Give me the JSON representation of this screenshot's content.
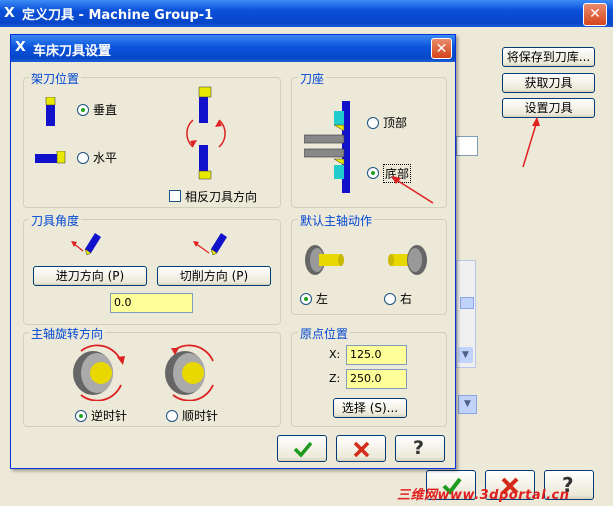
{
  "background_window": {
    "title": "定义刀具 - Machine Group-1",
    "buttons": {
      "save_to_library": "将保存到刀库...",
      "get_tool": "获取刀具",
      "set_tool": "设置刀具"
    }
  },
  "dialog": {
    "title": "车床刀具设置",
    "tool_mounting": {
      "label": "架刀位置",
      "vertical": "垂直",
      "horizontal": "水平",
      "vertical_selected": true,
      "reverse_direction": "相反刀具方向",
      "reverse_checked": false
    },
    "tool_holder": {
      "label": "刀座",
      "top": "顶部",
      "bottom": "底部",
      "bottom_selected": true
    },
    "tool_angle": {
      "label": "刀具角度",
      "plunge_button": "进刀方向 (P)",
      "cut_button": "切削方向 (P)",
      "angle_value": "0.0"
    },
    "default_spindle": {
      "label": "默认主轴动作",
      "left": "左",
      "right": "右",
      "left_selected": true
    },
    "spindle_rotation": {
      "label": "主轴旋转方向",
      "ccw": "逆时针",
      "cw": "顺时针",
      "ccw_selected": true
    },
    "origin": {
      "label": "原点位置",
      "x_label": "X:",
      "x_value": "125.0",
      "z_label": "Z:",
      "z_value": "250.0",
      "select_button": "选择 (S)..."
    }
  },
  "watermark": "三维网www.3dportal.cn",
  "colors": {
    "title_bar": "#0a4fd8",
    "group_label": "#0046d5",
    "input_bg": "#ffff99",
    "annotation_arrow": "#e02020"
  }
}
